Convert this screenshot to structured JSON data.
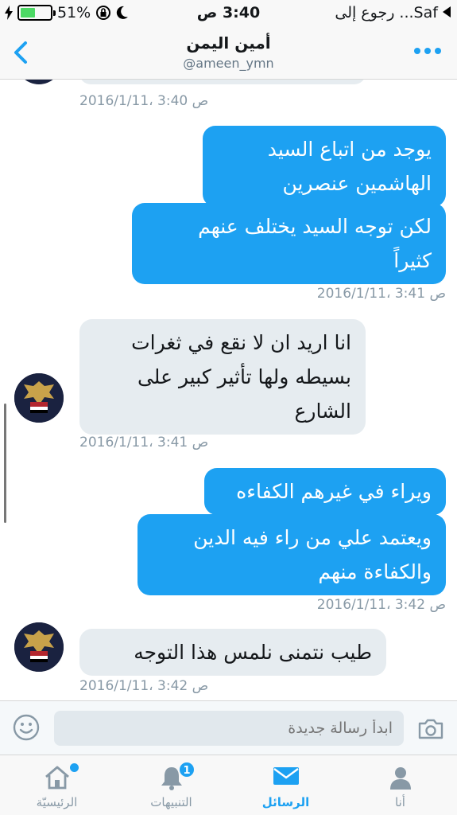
{
  "status_bar": {
    "battery": "51%",
    "time": "3:40 ص",
    "back_to_app": "رجوع إلى ...Saf",
    "battery_level": 0.51
  },
  "header": {
    "title": "أمين اليمن",
    "handle": "@ameen_ymn"
  },
  "messages": [
    {
      "type": "timestamp",
      "side": "left",
      "text": "2016/1/11، 3:40 ص"
    },
    {
      "type": "outgoing",
      "text": "يوجد من اتباع السيد\nالهاشمين عنصرين"
    },
    {
      "type": "outgoing",
      "text": "لكن توجه السيد يختلف عنهم\nكثيراً"
    },
    {
      "type": "timestamp",
      "side": "right",
      "text": "2016/1/11، 3:41 ص"
    },
    {
      "type": "incoming",
      "text": "انا اريد ان لا نقع في ثغرات\nبسيطه ولها تأثير كبير على\nالشارع"
    },
    {
      "type": "timestamp",
      "side": "left",
      "text": "2016/1/11، 3:41 ص"
    },
    {
      "type": "outgoing",
      "text": "ويراء في غيرهم الكفاءه"
    },
    {
      "type": "outgoing",
      "text": "ويعتمد علي من راء فيه الدين\nوالكفاءة منهم"
    },
    {
      "type": "timestamp",
      "side": "right",
      "text": "2016/1/11، 3:42 ص"
    },
    {
      "type": "incoming",
      "text": "طيب نتمنى نلمس هذا التوجه"
    },
    {
      "type": "timestamp",
      "side": "left",
      "text": "2016/1/11، 3:42 ص"
    }
  ],
  "composer": {
    "placeholder": "ابدأ رسالة جديدة"
  },
  "tabs": [
    {
      "label": "أنا",
      "icon": "person-icon"
    },
    {
      "label": "الرسائل",
      "icon": "envelope-icon",
      "active": true
    },
    {
      "label": "التنبيهات",
      "icon": "bell-icon",
      "badge": "1"
    },
    {
      "label": "الرئيسيّة",
      "icon": "home-icon",
      "dot": true
    }
  ],
  "colors": {
    "accent": "#1da1f2",
    "incoming_bubble": "#e6ecf0",
    "timestamp": "#8899a6"
  }
}
